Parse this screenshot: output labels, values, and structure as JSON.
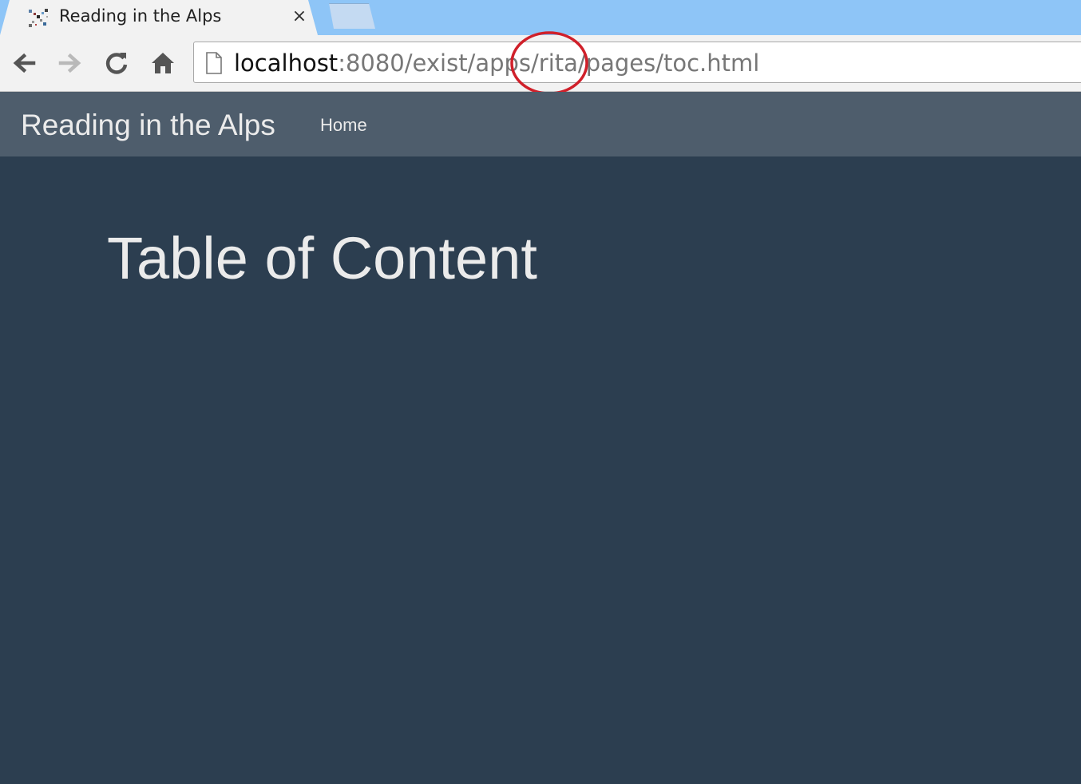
{
  "browser": {
    "tab_title": "Reading in the Alps",
    "tab_close_glyph": "×",
    "url_host": "localhost",
    "url_rest": ":8080/exist/apps/rita/pages/toc.html",
    "icons": [
      "app-favicon-icon",
      "close-icon",
      "back-icon",
      "forward-icon",
      "reload-icon",
      "home-icon",
      "page-icon"
    ],
    "colors": {
      "tab_strip": "#8ec5f7",
      "annotation": "#d0202a"
    }
  },
  "navbar": {
    "brand": "Reading in the Alps",
    "links": [
      "Home"
    ]
  },
  "main": {
    "heading": "Table of Content"
  },
  "theme": {
    "navbar_bg": "#4e5d6c",
    "page_bg": "#2c3e50",
    "text": "#ebebeb"
  }
}
